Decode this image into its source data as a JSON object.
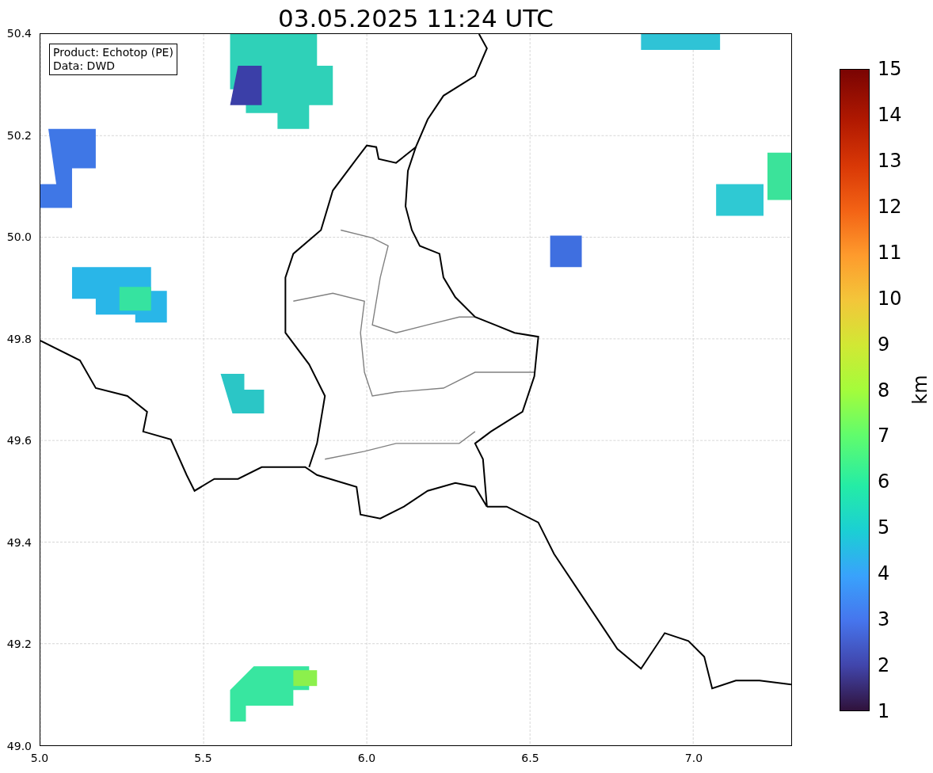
{
  "title": "03.05.2025 11:24 UTC",
  "info_box": {
    "lines": [
      "Product: Echotop (PE)",
      "Data: DWD"
    ]
  },
  "x_ticks": [
    "5.0",
    "5.5",
    "6.0",
    "6.5",
    "7.0"
  ],
  "y_ticks": [
    "50.4",
    "50.2",
    "50.0",
    "49.8",
    "49.6",
    "49.4",
    "49.2",
    "49.0"
  ],
  "colorbar": {
    "label": "km",
    "ticks": [
      "15",
      "14",
      "13",
      "12",
      "11",
      "10",
      "9",
      "8",
      "7",
      "6",
      "5",
      "4",
      "3",
      "2",
      "1"
    ]
  }
}
